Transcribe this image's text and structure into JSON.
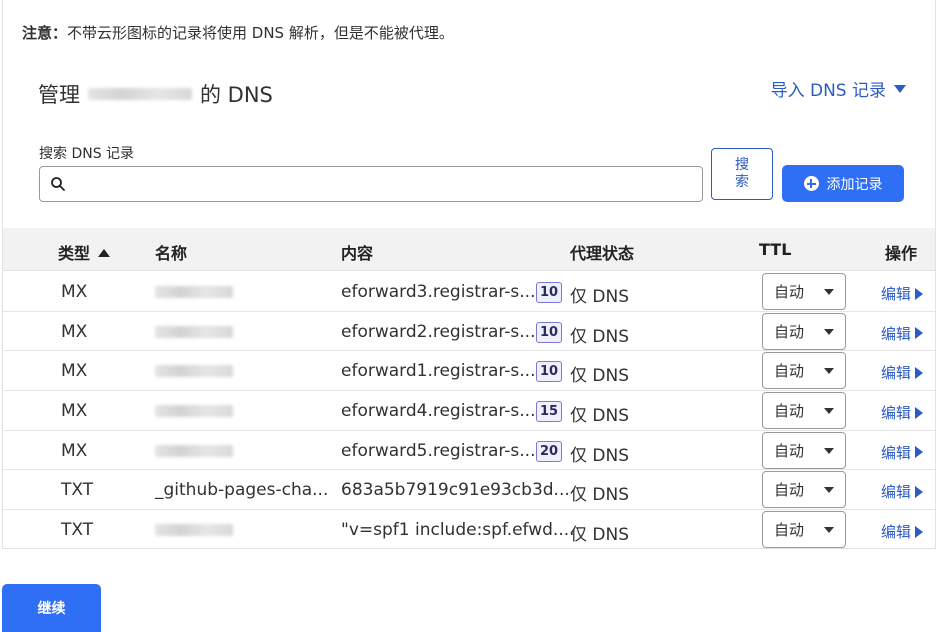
{
  "notice": {
    "label": "注意：",
    "text": "不带云形图标的记录将使用 DNS 解析，但是不能被代理。"
  },
  "header": {
    "title_prefix": "管理",
    "title_suffix": "的 DNS",
    "import_label": "导入 DNS 记录"
  },
  "search": {
    "label": "搜索 DNS 记录",
    "value": "",
    "button_label": "搜索",
    "add_label": "添加记录"
  },
  "table": {
    "columns": [
      "类型",
      "名称",
      "内容",
      "代理状态",
      "TTL",
      "操作"
    ],
    "rows": [
      {
        "type": "MX",
        "name": "",
        "content": "eforward3.registrar-s...",
        "priority": "10",
        "proxy": "仅 DNS",
        "ttl": "自动",
        "action": "编辑"
      },
      {
        "type": "MX",
        "name": "",
        "content": "eforward2.registrar-s...",
        "priority": "10",
        "proxy": "仅 DNS",
        "ttl": "自动",
        "action": "编辑"
      },
      {
        "type": "MX",
        "name": "",
        "content": "eforward1.registrar-s...",
        "priority": "10",
        "proxy": "仅 DNS",
        "ttl": "自动",
        "action": "编辑"
      },
      {
        "type": "MX",
        "name": "",
        "content": "eforward4.registrar-s...",
        "priority": "15",
        "proxy": "仅 DNS",
        "ttl": "自动",
        "action": "编辑"
      },
      {
        "type": "MX",
        "name": "",
        "content": "eforward5.registrar-s...",
        "priority": "20",
        "proxy": "仅 DNS",
        "ttl": "自动",
        "action": "编辑"
      },
      {
        "type": "TXT",
        "name": "_github-pages-cha...",
        "content": "683a5b7919c91e93cb3d...",
        "priority": "",
        "proxy": "仅 DNS",
        "ttl": "自动",
        "action": "编辑"
      },
      {
        "type": "TXT",
        "name": "",
        "content": "\"v=spf1 include:spf.efwd....",
        "priority": "",
        "proxy": "仅 DNS",
        "ttl": "自动",
        "action": "编辑"
      }
    ]
  },
  "footer": {
    "continue_label": "继续"
  },
  "colors": {
    "accent": "#2f6ff5",
    "link": "#2c5bc4",
    "header_bg": "#f2f2f2"
  }
}
